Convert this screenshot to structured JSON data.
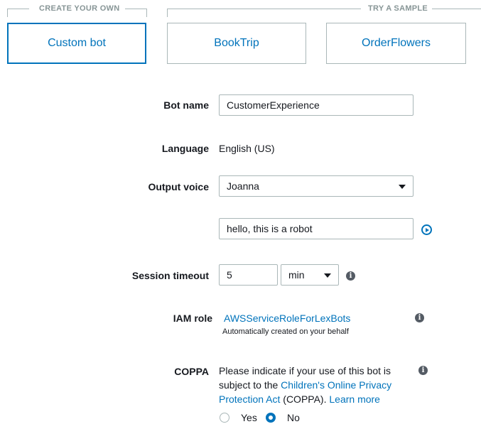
{
  "sections": {
    "create_own": "CREATE YOUR OWN",
    "try_sample": "TRY A SAMPLE"
  },
  "cards": [
    {
      "label": "Custom bot",
      "selected": true
    },
    {
      "label": "BookTrip",
      "selected": false
    },
    {
      "label": "OrderFlowers",
      "selected": false
    }
  ],
  "form": {
    "bot_name": {
      "label": "Bot name",
      "value": "CustomerExperience"
    },
    "language": {
      "label": "Language",
      "value": "English (US)"
    },
    "output_voice": {
      "label": "Output voice",
      "value": "Joanna",
      "sample_text": "hello, this is a robot"
    },
    "session_timeout": {
      "label": "Session timeout",
      "value": "5",
      "unit": "min"
    },
    "iam_role": {
      "label": "IAM role",
      "value": "AWSServiceRoleForLexBots",
      "note": "Automatically created on your behalf"
    },
    "coppa": {
      "label": "COPPA",
      "text_1": "Please indicate if your use of this bot is",
      "text_2": "subject to the",
      "link_1": "Children's Online Privacy",
      "link_2": "Protection Act",
      "text_3": "(COPPA).",
      "learn_more": "Learn more",
      "yes": "Yes",
      "no": "No",
      "selected": "No"
    }
  },
  "icons": {
    "info": "info-icon",
    "play": "play-icon",
    "dropdown": "caret-down-icon"
  },
  "colors": {
    "accent": "#0073bb",
    "border": "#aab7b8",
    "muted": "#879596",
    "text": "#16191f"
  }
}
